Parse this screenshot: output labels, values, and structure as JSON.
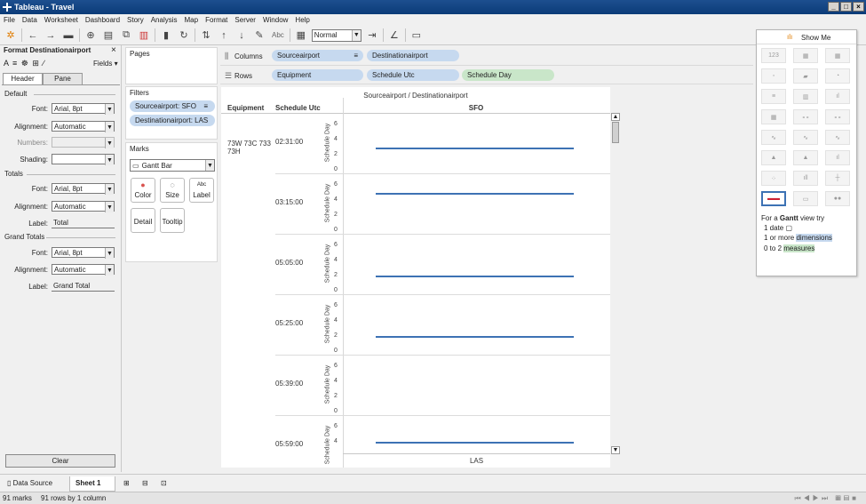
{
  "window": {
    "title": "Tableau - Travel",
    "controls": [
      "_",
      "□",
      "×"
    ]
  },
  "menu": [
    "File",
    "Data",
    "Worksheet",
    "Dashboard",
    "Story",
    "Analysis",
    "Map",
    "Format",
    "Server",
    "Window",
    "Help"
  ],
  "toolbar": {
    "abc_label": "Abc",
    "fit_value": "Normal"
  },
  "format_panel": {
    "title": "Format Destinationairport",
    "close": "×",
    "tools_glyphs": "A ≡ ☸ ⊞ ∕",
    "fields_label": "Fields ▾",
    "tabs": [
      "Header",
      "Pane"
    ],
    "default": {
      "section": "Default",
      "font_label": "Font:",
      "font": "Arial, 8pt",
      "alignment_label": "Alignment:",
      "alignment": "Automatic",
      "numbers_label": "Numbers:",
      "shading_label": "Shading:"
    },
    "totals": {
      "section": "Totals",
      "font_label": "Font:",
      "font": "Arial, 8pt",
      "alignment_label": "Alignment:",
      "alignment": "Automatic",
      "label_label": "Label:",
      "label": "Total"
    },
    "grand_totals": {
      "section": "Grand Totals",
      "font_label": "Font:",
      "font": "Arial, 8pt",
      "alignment_label": "Alignment:",
      "alignment": "Automatic",
      "label_label": "Label:",
      "label": "Grand Total"
    },
    "clear_label": "Clear"
  },
  "pages": {
    "title": "Pages"
  },
  "filters": {
    "title": "Filters",
    "items": [
      "Sourceairport: SFO",
      "Destinationairport: LAS"
    ]
  },
  "marks": {
    "title": "Marks",
    "type": "Gantt Bar",
    "buttons": [
      "Color",
      "Size",
      "Label",
      "Detail",
      "Tooltip"
    ]
  },
  "shelves": {
    "columns_label": "Columns",
    "columns": [
      "Sourceairport",
      "Destinationairport"
    ],
    "rows_label": "Rows",
    "rows": [
      "Equipment",
      "Schedule Utc",
      "Schedule Day"
    ]
  },
  "view": {
    "title": "Sourceairport / Destinationairport",
    "col_headers": [
      "Equipment",
      "Schedule Utc"
    ],
    "column_value": "SFO",
    "footer_value": "LAS",
    "equipment": "73W 73C 733 73H",
    "axis_title": "Schedule Day",
    "rows": [
      {
        "time": "02:31:00",
        "ticks": [
          "6",
          "4",
          "2",
          "0"
        ]
      },
      {
        "time": "03:15:00",
        "ticks": [
          "6",
          "4",
          "2",
          "0"
        ]
      },
      {
        "time": "05:05:00",
        "ticks": [
          "6",
          "4",
          "2",
          "0"
        ]
      },
      {
        "time": "05:25:00",
        "ticks": [
          "6",
          "4",
          "2",
          "0"
        ]
      },
      {
        "time": "05:39:00",
        "ticks": [
          "6",
          "4",
          "2",
          "0"
        ]
      },
      {
        "time": "05:59:00",
        "ticks": [
          "6",
          "4"
        ]
      }
    ]
  },
  "chart_data": {
    "type": "bar",
    "title": "Sourceairport / Destinationairport",
    "ylabel": "Schedule Day",
    "ylim": [
      0,
      7
    ],
    "categories": [
      "02:31:00",
      "03:15:00",
      "05:05:00",
      "05:25:00",
      "05:39:00",
      "05:59:00"
    ],
    "values": [
      3,
      5,
      2,
      2,
      null,
      4
    ]
  },
  "show_me": {
    "title": "Show Me",
    "hint_prefix": "For a",
    "hint_type": "Gantt",
    "hint_suffix": "view try",
    "req_date": "1 date",
    "req_dim_prefix": "1 or more",
    "req_dim": "dimensions",
    "req_mea_prefix": "0 to 2",
    "req_mea": "measures"
  },
  "bottom_tabs": {
    "data_source": "Data Source",
    "sheet": "Sheet 1"
  },
  "status": {
    "marks": "91 marks",
    "rows": "91 rows by 1 column"
  },
  "colors": {
    "accent": "#3d72b4",
    "pill_dimension": "#c6d9ef",
    "pill_measure": "#c9e6c9",
    "titlebar": "#0b3b78"
  }
}
